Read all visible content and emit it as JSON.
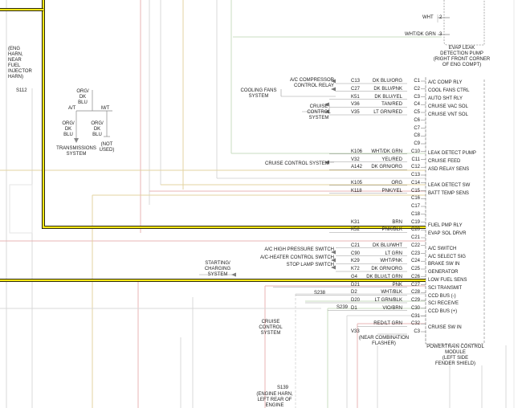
{
  "top": {
    "wht": "WHT",
    "wht_pin": "2",
    "whtdkgrn": "WHT/DK GRN",
    "whtdkgrn_pin": "3"
  },
  "evap_pump": "EVAP LEAK\nDETECTION PUMP\n(RIGHT FRONT CORNER\nOF ENG COMPT)",
  "eng_harn": "(ENG\nHARN,\nNEAR\nFUEL\nINJECTOR\nHARN)",
  "s112": "S112",
  "trans": {
    "wire": "ORG/\nDK\nBLU",
    "at": "A/T",
    "mt": "M/T",
    "left_wire": "ORG/\nDK\nBLU",
    "right_wire": "ORG/\nDK\nBLU",
    "system": "TRANSMISSIONS\nSYSTEM",
    "not_used": "(NOT\nUSED)"
  },
  "rows": [
    {
      "circuit": "C13",
      "color": "DK BLU/ORG",
      "pin": "C1"
    },
    {
      "circuit": "C27",
      "color": "DK BLU/PNK",
      "pin": "C2"
    },
    {
      "circuit": "K51",
      "color": "DK BLU/YEL",
      "pin": "C3"
    },
    {
      "circuit": "V36",
      "color": "TAN/RED",
      "pin": "C4"
    },
    {
      "circuit": "V35",
      "color": "LT GRN/RED",
      "pin": "C5"
    },
    {
      "circuit": "",
      "color": "",
      "pin": "C6"
    },
    {
      "circuit": "",
      "color": "",
      "pin": "C7"
    },
    {
      "circuit": "",
      "color": "",
      "pin": "C8"
    },
    {
      "circuit": "",
      "color": "",
      "pin": "C9"
    },
    {
      "circuit": "K106",
      "color": "WHT/DK GRN",
      "pin": "C10"
    },
    {
      "circuit": "V32",
      "color": "YEL/RED",
      "pin": "C11"
    },
    {
      "circuit": "A142",
      "color": "DK GRN/ORG",
      "pin": "C12"
    },
    {
      "circuit": "",
      "color": "",
      "pin": "C13"
    },
    {
      "circuit": "K105",
      "color": "ORG",
      "pin": "C14"
    },
    {
      "circuit": "K118",
      "color": "PNK/YEL",
      "pin": "C15"
    },
    {
      "circuit": "",
      "color": "",
      "pin": "C16"
    },
    {
      "circuit": "",
      "color": "",
      "pin": "C17"
    },
    {
      "circuit": "",
      "color": "",
      "pin": "C18"
    },
    {
      "circuit": "K31",
      "color": "BRN",
      "pin": "C19"
    },
    {
      "circuit": "K52",
      "color": "PNK/BLK",
      "pin": "C20"
    },
    {
      "circuit": "",
      "color": "",
      "pin": "C21"
    },
    {
      "circuit": "C21",
      "color": "DK BLU/WHT",
      "pin": "C22"
    },
    {
      "circuit": "C90",
      "color": "LT GRN",
      "pin": "C23"
    },
    {
      "circuit": "K29",
      "color": "WHT/PNK",
      "pin": "C24"
    },
    {
      "circuit": "K72",
      "color": "DK GRN/ORG",
      "pin": "C25"
    },
    {
      "circuit": "G4",
      "color": "DK BLU/LT GRN",
      "pin": "C26"
    },
    {
      "circuit": "D21",
      "color": "PNK",
      "pin": "C27"
    },
    {
      "circuit": "D2",
      "color": "WHT/BLK",
      "pin": "C28"
    },
    {
      "circuit": "D20",
      "color": "LT GRN/BLK",
      "pin": "C29"
    },
    {
      "circuit": "D1",
      "color": "VIO/BRN",
      "pin": "C30"
    },
    {
      "circuit": "",
      "color": "",
      "pin": "C31"
    },
    {
      "circuit": "",
      "color": "RED/LT GRN",
      "pin": "C32"
    },
    {
      "circuit": "V33",
      "color": "",
      "pin": "C3"
    }
  ],
  "pcm_labels": [
    "A/C COMP RLY",
    "COOL FANS CTRL",
    "AUTO SHT RLY",
    "CRUISE VAC SOL",
    "CRUISE VNT SOL",
    "LEAK DETECT PUMP",
    "CRUISE FEED",
    "ASD RELAY SENS",
    "LEAK DETECT SW",
    "BATT TEMP SENS",
    "FUEL PMP RLY",
    "EVAP SOL DRVR",
    "A/C SWITCH",
    "A/C SELECT SIG",
    "BRAKE SW IN",
    "GENERATOR",
    "LOW FUEL SENS",
    "SCI TRANSMIT",
    "CCD BUS (-)",
    "SCI RECEIVE",
    "CCD BUS (+)",
    "CRUISE SW IN"
  ],
  "pcm_name": "POWERTRAIN CONTROL\nMODULE\n(LEFT SIDE\nFENDER SHIELD)",
  "systems": {
    "ac_relay": "A/C COMPRESSOR\nCONTROL RELAY",
    "cooling": "COOLING FANS\nSYSTEM",
    "cruise1": "CRUISE\nCONTROL\nSYSTEM",
    "cruise2": "CRUISE CONTROL SYSTEM",
    "ac_high": "A/C HIGH PRESSURE SWITCH",
    "ac_heater": "A/C-HEATER CONTROL SWITCH",
    "stop_lamp": "STOP LAMP SWITCH",
    "charging": "STARTING/\nCHARGING\nSYSTEM",
    "cruise3": "CRUISE\nCONTROL\nSYSTEM",
    "flasher": "(NEAR COMBINATION\nFLASHER)"
  },
  "splices": {
    "s238": "S238",
    "s239": "S239",
    "s139": "S139",
    "s139_note": "(ENGINE HARN,\nLEFT REAR OF\nENGINE"
  }
}
